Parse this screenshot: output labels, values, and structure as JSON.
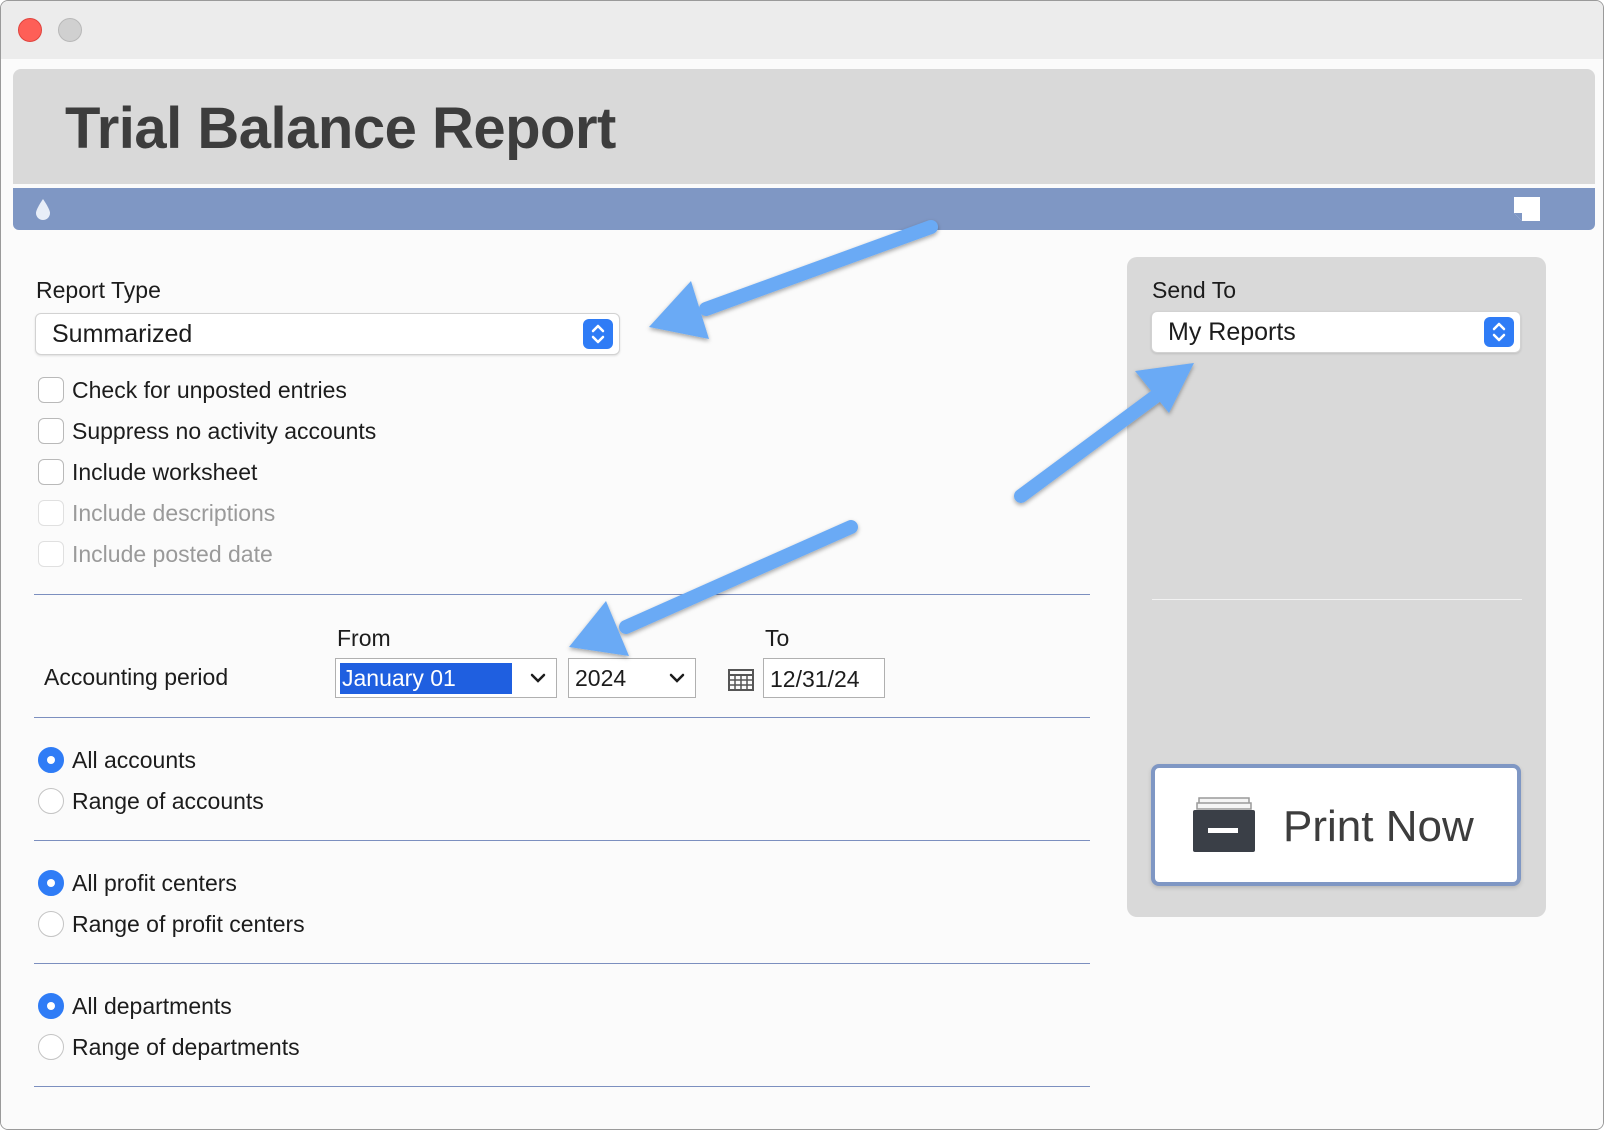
{
  "window": {
    "controls": [
      "close",
      "minimize"
    ]
  },
  "header": {
    "title": "Trial Balance Report"
  },
  "toolbar": {
    "left_icon": "drop-icon",
    "right_icon": "note-icon"
  },
  "report_type": {
    "label": "Report Type",
    "value": "Summarized"
  },
  "options": [
    {
      "label": "Check for unposted entries",
      "checked": false,
      "enabled": true
    },
    {
      "label": "Suppress no activity accounts",
      "checked": false,
      "enabled": true
    },
    {
      "label": "Include worksheet",
      "checked": false,
      "enabled": true
    },
    {
      "label": "Include descriptions",
      "checked": false,
      "enabled": false
    },
    {
      "label": "Include posted date",
      "checked": false,
      "enabled": false
    }
  ],
  "period": {
    "label": "Accounting period",
    "from_label": "From",
    "to_label": "To",
    "from_month": "January 01",
    "from_year": "2024",
    "to_date": "12/31/24"
  },
  "accounts": {
    "all_label": "All accounts",
    "range_label": "Range of accounts",
    "selected": "all"
  },
  "profit_centers": {
    "all_label": "All profit centers",
    "range_label": "Range of profit centers",
    "selected": "all"
  },
  "departments": {
    "all_label": "All departments",
    "range_label": "Range of departments",
    "selected": "all"
  },
  "send_to": {
    "label": "Send To",
    "value": "My Reports"
  },
  "print_button": {
    "label": "Print Now",
    "icon": "printer-icon"
  },
  "colors": {
    "accent": "#2f7cf6",
    "bar": "#7f97c4",
    "annotation": "#6aaaf5"
  }
}
